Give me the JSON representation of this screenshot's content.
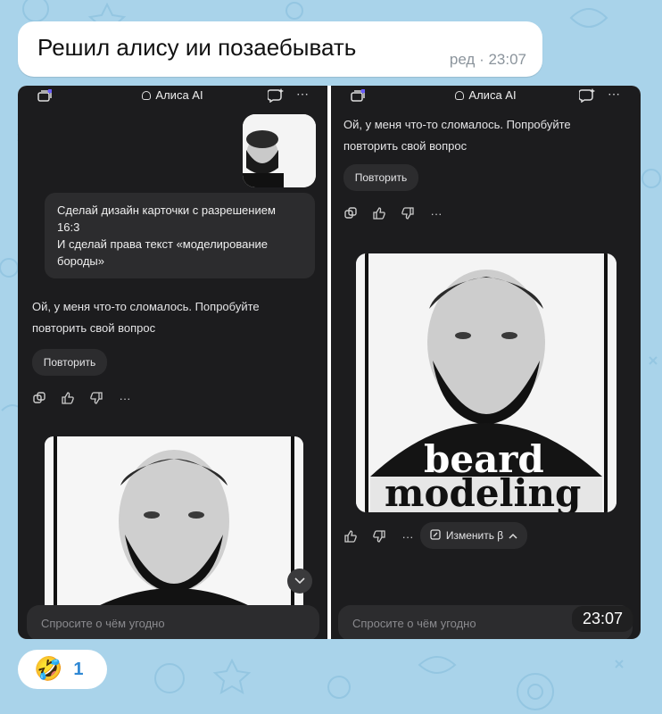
{
  "message": {
    "text": "Решил алису ии позаебывать",
    "meta": "ред · 23:07"
  },
  "left_phone": {
    "app_title": "Алиса AI",
    "user_message": {
      "line1": "Сделай дизайн карточки с разрешением",
      "line2": "16:3",
      "line3": "И сделай права текст «моделирование",
      "line4": "бороды»"
    },
    "reply_line1": "Ой, у меня что-то сломалось. Попробуйте",
    "reply_line2": "повторить свой вопрос",
    "retry_label": "Повторить",
    "more_label": "···",
    "input_placeholder": "Спросите о чём угодно"
  },
  "right_phone": {
    "app_title": "Алиса AI",
    "reply_line1": "Ой, у меня что-то сломалось. Попробуйте",
    "reply_line2": "повторить свой вопрос",
    "retry_label": "Повторить",
    "more_label": "···",
    "image_text_line1": "beard",
    "image_text_line2": "modeling",
    "edit_label": "Изменить β",
    "input_placeholder": "Спросите о чём угодно",
    "timestamp": "23:07"
  },
  "reaction": {
    "emoji": "🤣",
    "count": "1"
  },
  "colors": {
    "wallpaper": "#a9d3ea",
    "bubble": "#ffffff",
    "phone_bg": "#1c1c1e",
    "accent_blue": "#2f88d4"
  }
}
